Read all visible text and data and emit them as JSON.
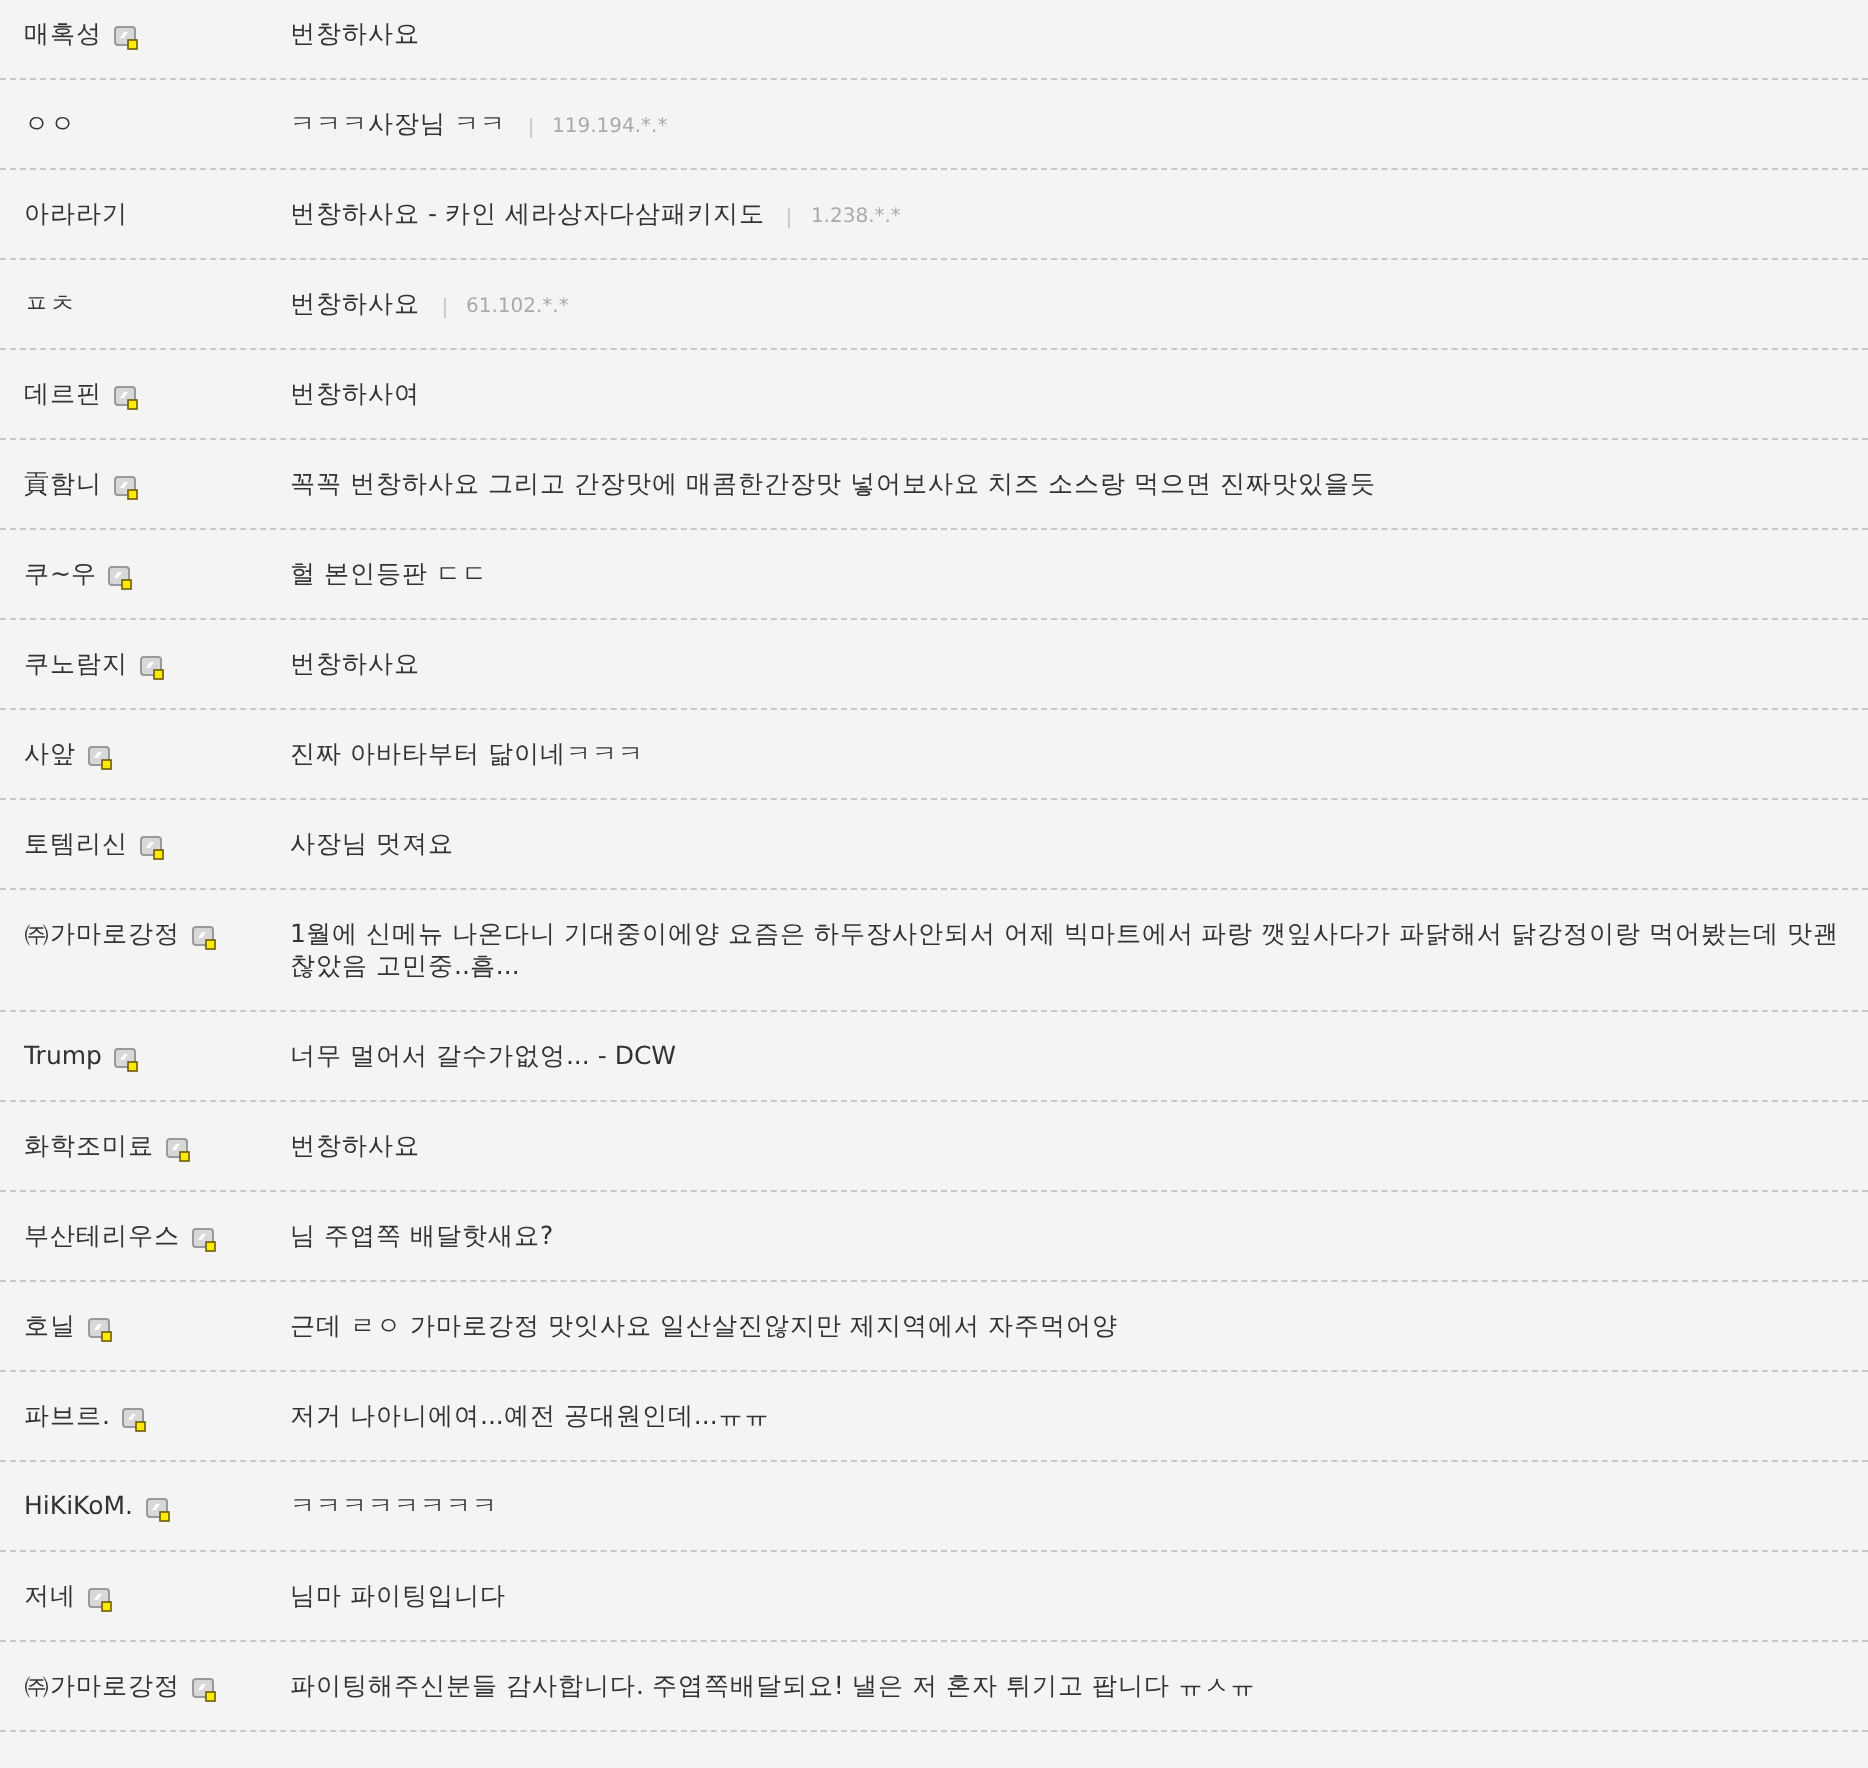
{
  "comments": [
    {
      "name": "매혹성",
      "member": true,
      "text": "번창하사요"
    },
    {
      "name": "ㅇㅇ",
      "member": false,
      "text": "ㅋㅋㅋ사장님 ㅋㅋ",
      "ip": "119.194.*.*"
    },
    {
      "name": "아라라기",
      "member": false,
      "text": "번창하사요 - 카인 세라상자다삼패키지도",
      "ip": "1.238.*.*"
    },
    {
      "name": "ㅍㅊ",
      "member": false,
      "text": "번창하사요",
      "ip": "61.102.*.*"
    },
    {
      "name": "데르핀",
      "member": true,
      "text": "번창하사여"
    },
    {
      "name": "貢함니",
      "member": true,
      "text": "꼭꼭 번창하사요 그리고 간장맛에 매콤한간장맛 넣어보사요 치즈 소스랑 먹으면 진짜맛있을듯"
    },
    {
      "name": "쿠~우",
      "member": true,
      "text": "헐 본인등판 ㄷㄷ"
    },
    {
      "name": "쿠노람지",
      "member": true,
      "text": "번창하사요"
    },
    {
      "name": "사앞",
      "member": true,
      "text": "진짜 아바타부터 닮이네ㅋㅋㅋ"
    },
    {
      "name": "토템리신",
      "member": true,
      "text": "사장님 멋져요"
    },
    {
      "name": "㈜가마로강정",
      "member": true,
      "text": "1월에 신메뉴 나온다니 기대중이에양 요즘은 하두장사안되서 어제 빅마트에서 파랑 깻잎사다가 파닭해서 닭강정이랑 먹어봤는데 맛괜찮았음 고민중..흠..."
    },
    {
      "name": "Trump",
      "member": true,
      "text": "너무 멀어서 갈수가없엉... - DCW"
    },
    {
      "name": "화학조미료",
      "member": true,
      "text": "번창하사요"
    },
    {
      "name": "부산테리우스",
      "member": true,
      "text": "님 주엽쪽 배달핫새요?"
    },
    {
      "name": "호닐",
      "member": true,
      "text": "근데 ㄹㅇ 가마로강정 맛잇사요 일산살진않지만 제지역에서 자주먹어양"
    },
    {
      "name": "파브르.",
      "member": true,
      "text": "저거 나아니에여...예전 공대원인데...ㅠㅠ"
    },
    {
      "name": "HiKiKoM.",
      "member": true,
      "text": "ㅋㅋㅋㅋㅋㅋㅋㅋ"
    },
    {
      "name": "저네",
      "member": true,
      "text": "님마 파이팅입니다"
    },
    {
      "name": "㈜가마로강정",
      "member": true,
      "text": "파이팅해주신분들 감사합니다. 주엽쪽배달되요! 낼은 저 혼자 튀기고 팝니다 ㅠㅅㅠ"
    }
  ]
}
